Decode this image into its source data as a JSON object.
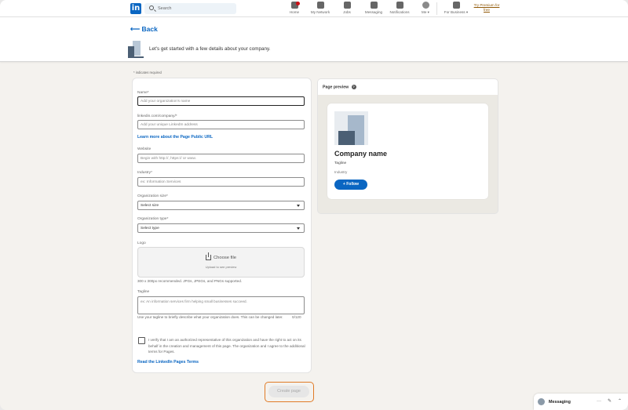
{
  "nav": {
    "logo_text": "in",
    "search_placeholder": "Search",
    "items": [
      {
        "label": "Home"
      },
      {
        "label": "My Network"
      },
      {
        "label": "Jobs"
      },
      {
        "label": "Messaging"
      },
      {
        "label": "Notifications"
      },
      {
        "label": "Me ▾"
      },
      {
        "label": "For Business ▾"
      }
    ],
    "premium_label": "Try Premium for free"
  },
  "header": {
    "back_label": "⟵ Back",
    "subtitle": "Let's get started with a few details about your company."
  },
  "form": {
    "required_note": "* indicates required",
    "name_label": "Name*",
    "name_placeholder": "Add your organization's name",
    "url_label": "linkedin.com/company/*",
    "url_placeholder": "Add your unique LinkedIn address",
    "url_link": "Learn more about the Page Public URL",
    "website_label": "Website",
    "website_placeholder": "Begin with http://, https:// or www.",
    "industry_label": "Industry*",
    "industry_placeholder": "ex: Information Services",
    "size_label": "Organization size*",
    "size_value": "Select size",
    "type_label": "Organization type*",
    "type_value": "Select type",
    "logo_label": "Logo",
    "upload_label": "Choose file",
    "upload_sub": "Upload to see preview",
    "logo_hint": "300 x 300px recommended. JPGs, JPEGs, and PNGs supported.",
    "tagline_label": "Tagline",
    "tagline_placeholder": "ex: An information services firm helping small businesses succeed.",
    "tagline_hint": "Use your tagline to briefly describe what your organization does. This can be changed later.",
    "tagline_counter": "0/120",
    "verify_text": "I verify that I am an authorized representative of this organization and have the right to act on its behalf in the creation and management of this page. The organization and I agree to the additional terms for Pages.",
    "terms_link": "Read the LinkedIn Pages Terms"
  },
  "preview": {
    "title": "Page preview",
    "help": "?",
    "company_name": "Company name",
    "tagline": "Tagline",
    "industry": "Industry",
    "follow_label": "+ Follow"
  },
  "actions": {
    "create_label": "Create page"
  },
  "messaging": {
    "label": "Messaging",
    "more": "···",
    "compose": "✎",
    "collapse": "⌃"
  }
}
